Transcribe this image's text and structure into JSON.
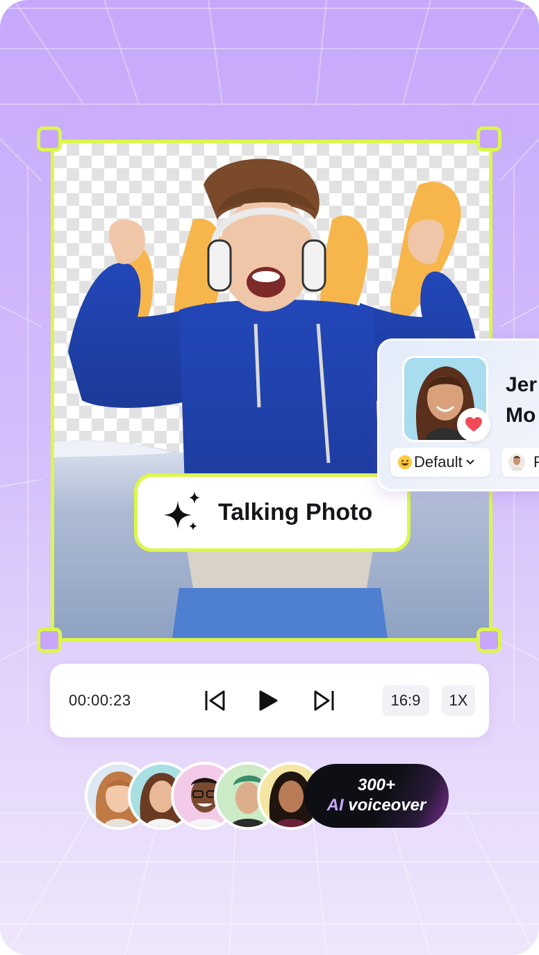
{
  "badge": {
    "label": "Talking Photo"
  },
  "profile_card": {
    "name_line1": "Jer",
    "name_line2": "Mo",
    "emotion_value": "Default",
    "second_pill_label": "P"
  },
  "player": {
    "timestamp": "00:00:23",
    "aspect_ratio": "16:9",
    "speed": "1X"
  },
  "voiceover": {
    "count": "300+",
    "label_ai": "AI",
    "label_voiceover": "voiceover"
  },
  "colors": {
    "accent": "#dcf74a",
    "background": "#c6a8fb",
    "handle": "#c8a6fb",
    "heart": "#ef4a55"
  },
  "icons": [
    "sparkle-icon",
    "heart-icon",
    "chevron-down-icon",
    "skip-back-icon",
    "play-icon",
    "skip-forward-icon",
    "smile-emoji-icon"
  ]
}
